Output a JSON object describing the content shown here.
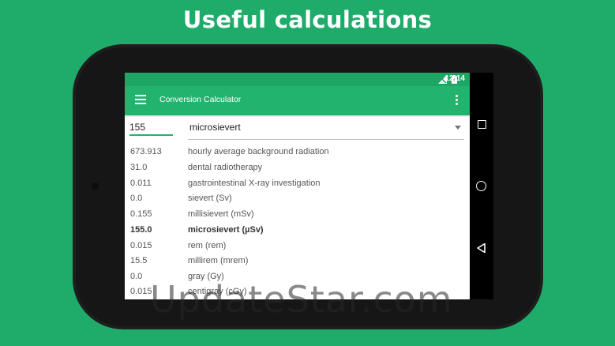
{
  "promo": {
    "title": "Useful calculations"
  },
  "status_bar": {
    "time": "12:14"
  },
  "app_bar": {
    "title": "Conversion Calculator"
  },
  "input": {
    "value": "155"
  },
  "unit_select": {
    "selected": "microsievert"
  },
  "results": [
    {
      "value": "673.913",
      "unit": "hourly average background radiation",
      "bold": false
    },
    {
      "value": "31.0",
      "unit": "dental radiotherapy",
      "bold": false
    },
    {
      "value": "0.011",
      "unit": "gastrointestinal X-ray investigation",
      "bold": false
    },
    {
      "value": "0.0",
      "unit": "sievert (Sv)",
      "bold": false
    },
    {
      "value": "0.155",
      "unit": "millisievert (mSv)",
      "bold": false
    },
    {
      "value": "155.0",
      "unit": "microsievert (µSv)",
      "bold": true
    },
    {
      "value": "0.015",
      "unit": "rem (rem)",
      "bold": false
    },
    {
      "value": "15.5",
      "unit": "millirem (mrem)",
      "bold": false
    },
    {
      "value": "0.0",
      "unit": "gray (Gy)",
      "bold": false
    },
    {
      "value": "0.015",
      "unit": "centigray (cGy)",
      "bold": false
    }
  ],
  "watermark": {
    "text": "UpdateStar.com"
  },
  "colors": {
    "background": "#1fac6b",
    "app_bar": "#22b36f",
    "status_bar": "#1ea764"
  },
  "icons": [
    "menu-icon",
    "overflow-icon",
    "signal-icon",
    "battery-icon",
    "dropdown-arrow-icon",
    "recents-icon",
    "home-icon",
    "back-icon"
  ]
}
